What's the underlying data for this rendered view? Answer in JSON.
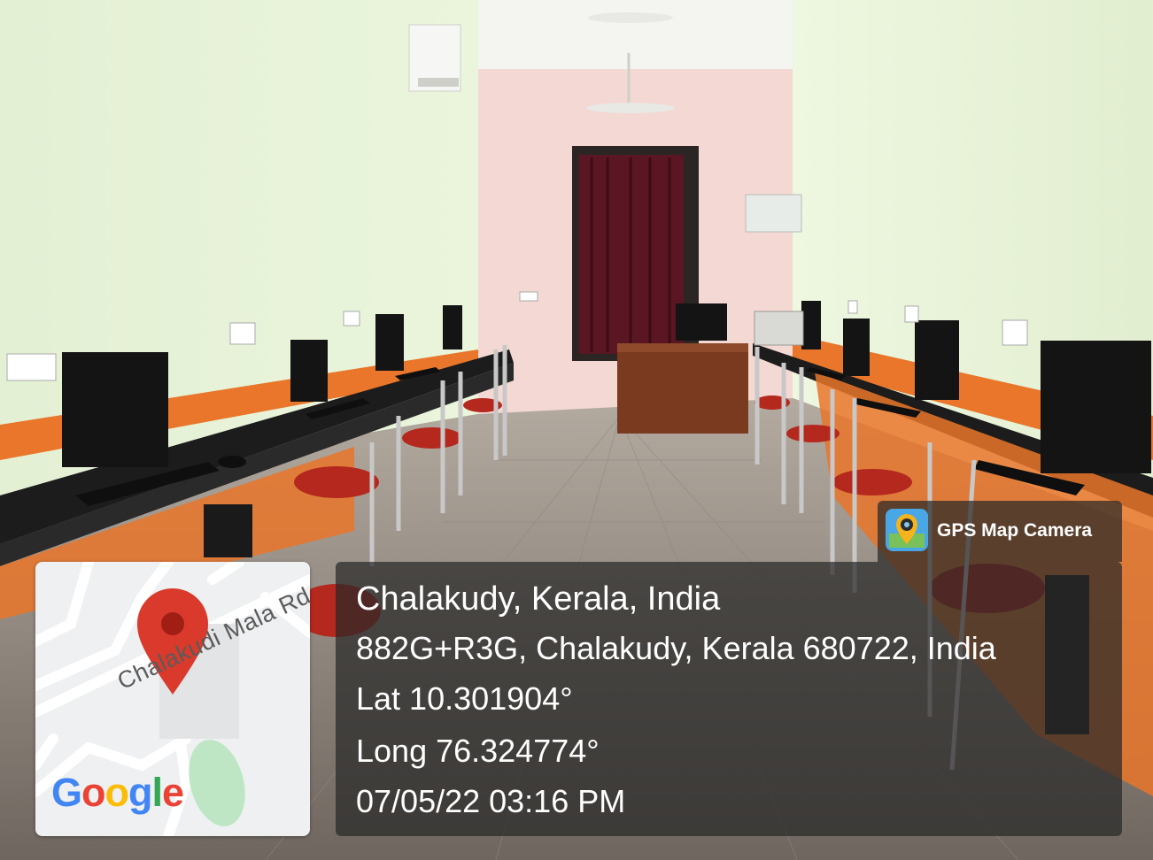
{
  "photo": {
    "description_icon": "computer-lab-photo"
  },
  "watermark": {
    "app_name": "GPS Map Camera",
    "app_icon": "gps-map-camera-icon"
  },
  "location": {
    "place": "Chalakudy, Kerala, India",
    "address": "882G+R3G, Chalakudy, Kerala 680722, India",
    "lat": "Lat 10.301904°",
    "long": "Long 76.324774°",
    "datetime": "07/05/22 03:16 PM"
  },
  "map": {
    "road_label": "Chalakudi Mala Rd",
    "logo": "Google",
    "pin_icon": "map-pin-icon",
    "colors": {
      "pin": "#d93a2b",
      "road": "#ffffff",
      "park": "#bfe6c4",
      "background": "#eef0f1"
    }
  }
}
